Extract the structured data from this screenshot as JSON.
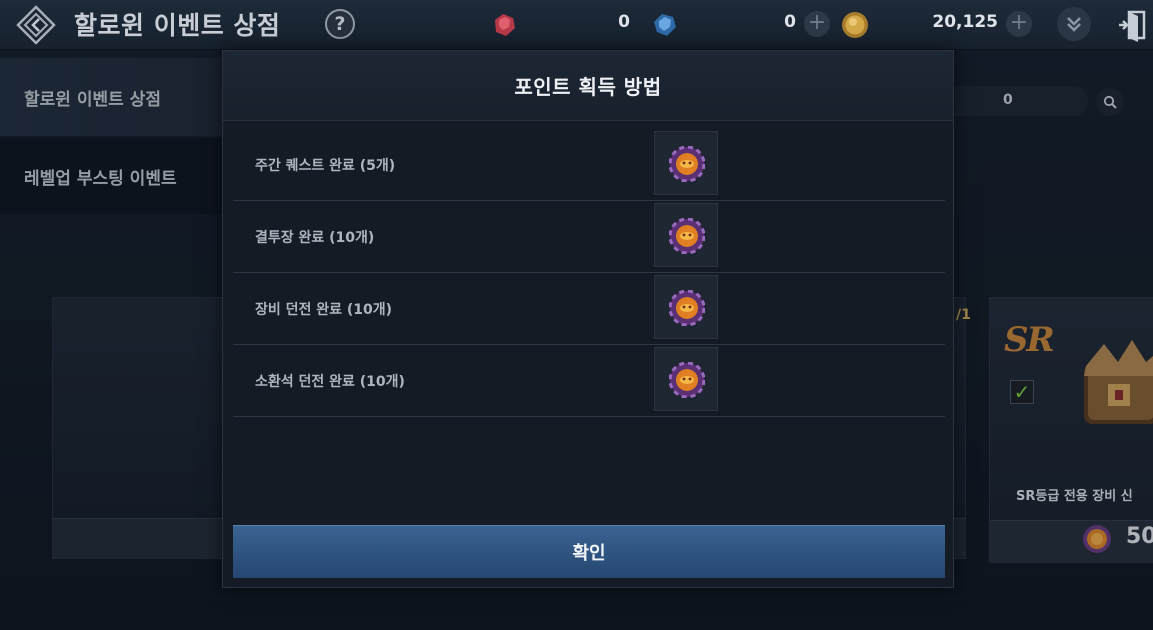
{
  "topbar": {
    "title": "할로윈 이벤트 상점",
    "help_glyph": "?",
    "currencies": [
      {
        "icon": "red-gem-icon",
        "value": "0"
      },
      {
        "icon": "blue-gem-icon",
        "value": "0"
      },
      {
        "icon": "gold-coin-icon",
        "value": "20,125"
      }
    ],
    "plus_glyph": "+"
  },
  "sidebar": {
    "items": [
      {
        "label": "할로윈 이벤트 상점",
        "active": true
      },
      {
        "label": "레벨업 부스팅 이벤트",
        "active": false
      }
    ]
  },
  "background": {
    "search_value": "0",
    "limit_fraction": "/1",
    "sr_card": {
      "grade": "SR",
      "name": "SR등급 전용 장비 신",
      "price": "50"
    }
  },
  "modal": {
    "title": "포인트 획득 방법",
    "rows": [
      {
        "label": "주간 퀘스트 완료 (5개)",
        "icon": "halloween-token-icon"
      },
      {
        "label": "결투장 완료 (10개)",
        "icon": "halloween-token-icon"
      },
      {
        "label": "장비 던전 완료 (10개)",
        "icon": "halloween-token-icon"
      },
      {
        "label": "소환석 던전 완료 (10개)",
        "icon": "halloween-token-icon"
      }
    ],
    "confirm_label": "확인"
  },
  "colors": {
    "accent_button": "#2e5380",
    "sr_grade": "#c9873a",
    "check_green": "#7ed241"
  }
}
